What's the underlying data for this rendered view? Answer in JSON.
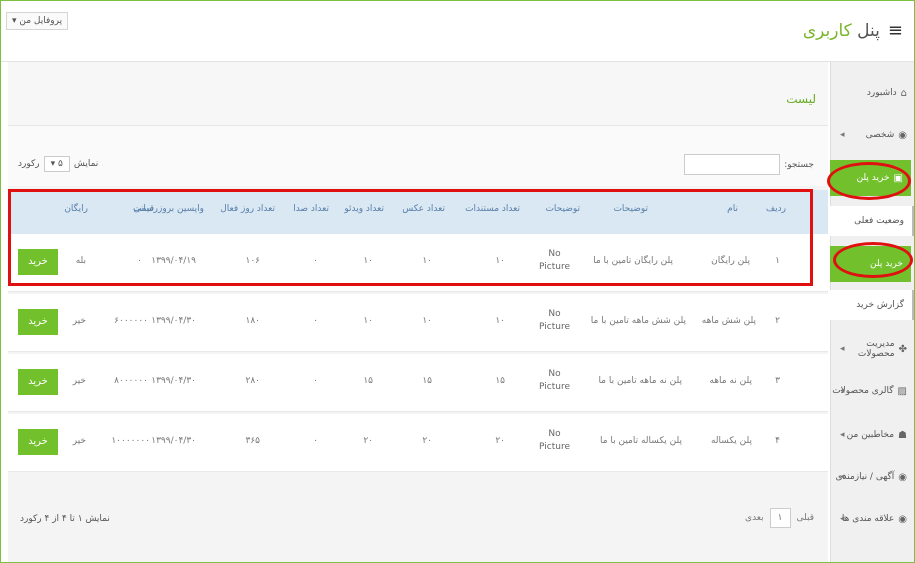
{
  "header": {
    "title_main": "کاربری",
    "title_prefix": "پنل",
    "menu_icon": "hamburger-icon",
    "profile_label": "پروفایل من"
  },
  "sidebar": {
    "items": [
      {
        "label": "داشبورد",
        "icon": "dashboard-icon"
      },
      {
        "label": "شخصی",
        "icon": "user-icon"
      },
      {
        "label": "خرید پلن",
        "icon": "cart-icon"
      },
      {
        "label": "وضعیت فعلی",
        "icon": ""
      },
      {
        "label": "خرید پلن",
        "icon": ""
      },
      {
        "label": "گزارش خرید",
        "icon": ""
      },
      {
        "label": "مدیریت محصولات",
        "icon": "products-icon"
      },
      {
        "label": "گالری محصولات",
        "icon": "gallery-icon"
      },
      {
        "label": "مخاطبین من",
        "icon": "contacts-icon"
      },
      {
        "label": "آگهی / نیازمندی",
        "icon": "ads-icon"
      },
      {
        "label": "علاقه مندی ها",
        "icon": "favorites-icon"
      }
    ]
  },
  "panel": {
    "title": "لیست",
    "search_label": "جستجو:",
    "length_prefix": "نمایش",
    "length_value": "۵",
    "length_suffix": "رکورد",
    "info": "نمایش ۱ تا ۴ از ۴ رکورد",
    "pager_prev": "قبلی",
    "pager_page": "۱",
    "pager_next": "بعدی"
  },
  "table": {
    "headers": [
      "ردیف",
      "نام",
      "توضیحات",
      "توضیحات",
      "تعداد مستندات",
      "تعداد عکس",
      "تعداد ویدئو",
      "تعداد صدا",
      "تعداد روز فعال",
      "واپسین بروزرسانی",
      "قیمت",
      "رایگان"
    ],
    "rows": [
      {
        "index": "۱",
        "name": "پلن رایگان",
        "desc": "پلن رایگان تامین با ما",
        "pic": "No Picture",
        "docs": "۱۰",
        "photos": "۱۰",
        "videos": "۱۰",
        "sounds": "۰",
        "days": "۱۰۶",
        "updated": "۱۳۹۹/۰۴/۱۹",
        "price": "۰",
        "free": "بله",
        "buy": "خرید"
      },
      {
        "index": "۲",
        "name": "پلن شش ماهه",
        "desc": "پلن شش ماهه تامین با ما",
        "pic": "No Picture",
        "docs": "۱۰",
        "photos": "۱۰",
        "videos": "۱۰",
        "sounds": "۰",
        "days": "۱۸۰",
        "updated": "۱۳۹۹/۰۴/۳۰",
        "price": "۶۰۰۰۰۰۰",
        "free": "خیر",
        "buy": "خرید"
      },
      {
        "index": "۳",
        "name": "پلن نه ماهه",
        "desc": "پلن نه ماهه تامین با ما",
        "pic": "No Picture",
        "docs": "۱۵",
        "photos": "۱۵",
        "videos": "۱۵",
        "sounds": "۰",
        "days": "۲۸۰",
        "updated": "۱۳۹۹/۰۴/۳۰",
        "price": "۸۰۰۰۰۰۰",
        "free": "خیر",
        "buy": "خرید"
      },
      {
        "index": "۴",
        "name": "پلن یکساله",
        "desc": "پلن یکساله تامین با ما",
        "pic": "No Picture",
        "docs": "۲۰",
        "photos": "۲۰",
        "videos": "۲۰",
        "sounds": "۰",
        "days": "۳۶۵",
        "updated": "۱۳۹۹/۰۴/۳۰",
        "price": "۱۰۰۰۰۰۰۰",
        "free": "خیر",
        "buy": "خرید"
      }
    ]
  },
  "colors": {
    "accent": "#72c02c",
    "highlight": "#e01010",
    "header_bg": "#d9e8f3"
  }
}
